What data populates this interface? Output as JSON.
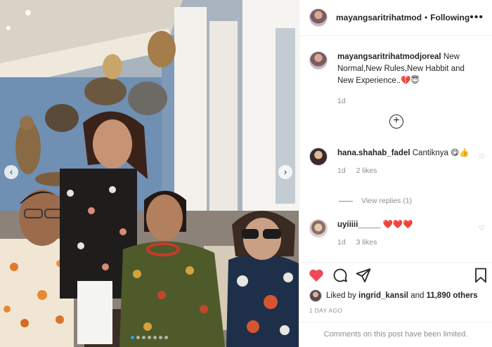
{
  "header": {
    "username": "mayangsaritrihatmodjc",
    "separator": "•",
    "follow_status": "Following",
    "more_icon": "more-icon"
  },
  "caption": {
    "username": "mayangsaritrihatmodjoreal",
    "text": "New Normal,New Rules,New Habbit and New Experience..💔😇",
    "time": "1d"
  },
  "load_more_icon": "add-circle-icon",
  "comments": [
    {
      "username": "hana.shahab_fadel",
      "text": "Cantiknya 😋👍",
      "time": "1d",
      "likes": "2 likes"
    },
    {
      "username": "uyiiiii_____",
      "text": "❤️❤️❤️",
      "time": "1d",
      "likes": "3 likes"
    }
  ],
  "view_replies": "View replies (1)",
  "likes": {
    "prefix": "Liked by",
    "user": "ingrid_kansil",
    "middle": "and",
    "count": "11,890 others"
  },
  "post_time": "1 DAY AGO",
  "comments_limited": "Comments on this post have been limited.",
  "colors": {
    "like_red": "#ed4956",
    "accent_blue": "#3897f0",
    "muted": "#8e8e8e"
  },
  "carousel": {
    "slide_count": 7,
    "active_index": 0
  }
}
